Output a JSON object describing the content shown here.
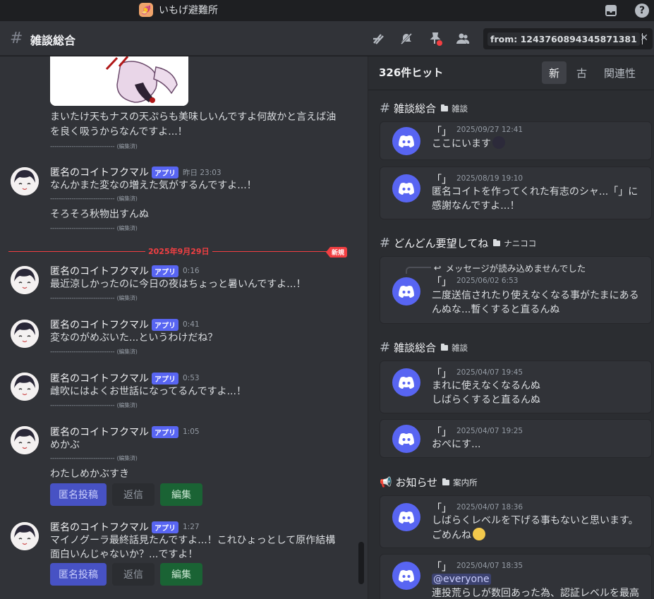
{
  "titlebar": {
    "server_name": "いもげ避難所"
  },
  "header": {
    "channel_name": "雑談総合",
    "search_query": "from: 1243760894345871381"
  },
  "chat": {
    "top_message": {
      "line1": "まいたけ天もナスの天ぷらも美味しいんですよ何故かと言えば油",
      "line2": "を良く吸うからなんですよ...！"
    },
    "separator": "------------------------------",
    "edited_label": "(編集済)",
    "date_divider": "2025年9月29日",
    "new_label": "新規",
    "messages": [
      {
        "username": "匿名のコイトフクマル",
        "badge": "アプリ",
        "time": "昨日 23:03",
        "text": "なんかまた変なの増えた気がするんですよ...！",
        "followup": "そろそろ秋物出すんぬ"
      },
      {
        "username": "匿名のコイトフクマル",
        "badge": "アプリ",
        "time": "0:16",
        "text": "最近涼しかったのに今日の夜はちょっと暑いんですよ...！"
      },
      {
        "username": "匿名のコイトフクマル",
        "badge": "アプリ",
        "time": "0:41",
        "text": "変なのがめぶいた...というわけだね？"
      },
      {
        "username": "匿名のコイトフクマル",
        "badge": "アプリ",
        "time": "0:53",
        "text": "雌吹にはよくお世話になってるんですよ...！"
      },
      {
        "username": "匿名のコイトフクマル",
        "badge": "アプリ",
        "time": "1:05",
        "text": "めかぶ",
        "followup": "わたしめかぶすき"
      },
      {
        "username": "匿名のコイトフクマル",
        "badge": "アプリ",
        "time": "1:27",
        "text": "マイノグーラ最終話見たんですよ...！これひょっとして原作結構",
        "text2": "面白いんじゃないか？...ですよ！"
      }
    ],
    "buttons": {
      "anon": "匿名投稿",
      "reply": "返信",
      "edit": "編集"
    }
  },
  "results": {
    "count": "326件ヒット",
    "sort_tabs": [
      "新",
      "古",
      "関連性"
    ],
    "groups": [
      {
        "channel": "雑談総合",
        "category": "雑談"
      },
      {
        "channel": "どんどん要望してね",
        "category": "ナニココ"
      },
      {
        "channel": "雑談総合",
        "category": "雑談"
      },
      {
        "channel": "お知らせ",
        "category": "案内所"
      }
    ],
    "cards": [
      {
        "author": "「」",
        "time": "2025/09/27 12:41",
        "text": "ここにいます"
      },
      {
        "author": "「」",
        "time": "2025/08/19 19:10",
        "text": "匿名コイトを作ってくれた有志のシャ...「」に",
        "text2": "感謝なんですよ...！"
      },
      {
        "author": "「」",
        "time": "2025/06/02 6:53",
        "reply": "メッセージが読み込めませんでした",
        "text": "二度送信されたり使えなくなる事がたまにある",
        "text2": "んぬな...暫くすると直るんぬ"
      },
      {
        "author": "「」",
        "time": "2025/04/07 19:45",
        "text": "まれに使えなくなるんぬ",
        "text2": "しばらくすると直るんぬ"
      },
      {
        "author": "「」",
        "time": "2025/04/07 19:25",
        "text": "おぺにす..."
      },
      {
        "author": "「」",
        "time": "2025/04/07 18:36",
        "text": "しばらくレベルを下げる事もないと思います。",
        "text2": "ごめんね"
      },
      {
        "author": "「」",
        "time": "2025/04/07 18:35",
        "mention": "@everyone",
        "text": "連投荒らしが数回あった為、認証レベルを最高"
      }
    ]
  }
}
